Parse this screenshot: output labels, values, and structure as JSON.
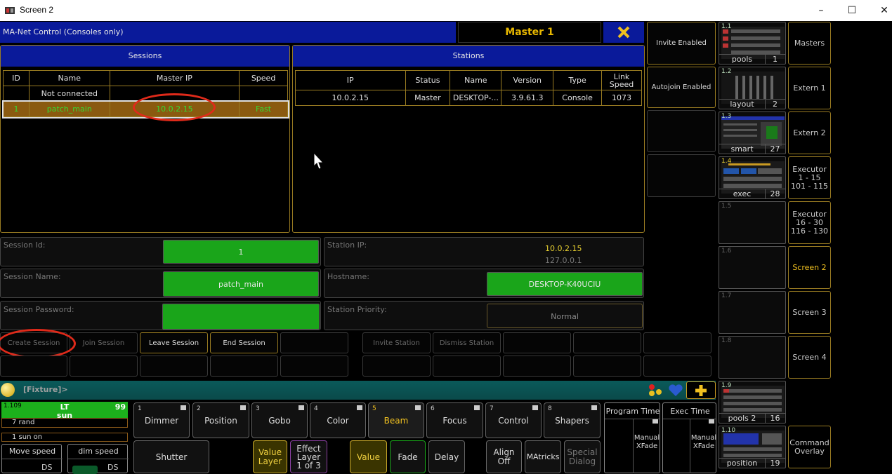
{
  "window": {
    "title": "Screen 2"
  },
  "panel": {
    "title": "MA-Net Control (Consoles only)",
    "master_label": "Master 1"
  },
  "sessions": {
    "header": "Sessions",
    "columns": [
      "ID",
      "Name",
      "Master IP",
      "Speed"
    ],
    "rows": [
      {
        "id": "",
        "name": "Not connected",
        "ip": "",
        "speed": ""
      },
      {
        "id": "1",
        "name": "patch_main",
        "ip": "10.0.2.15",
        "speed": "Fast"
      }
    ]
  },
  "stations": {
    "header": "Stations",
    "columns": [
      "IP",
      "Status",
      "Name",
      "Version",
      "Type",
      "Link Speed"
    ],
    "rows": [
      {
        "ip": "10.0.2.15",
        "status": "Master",
        "name": "DESKTOP-...",
        "version": "3.9.61.3",
        "type": "Console",
        "link": "1073"
      }
    ]
  },
  "fields": {
    "session_id_label": "Session Id:",
    "session_id": "1",
    "session_name_label": "Session Name:",
    "session_name": "patch_main",
    "session_password_label": "Session Password:",
    "session_password": "",
    "station_ip_label": "Station IP:",
    "station_ip_1": "10.0.2.15",
    "station_ip_2": "127.0.0.1",
    "hostname_label": "Hostname:",
    "hostname": "DESKTOP-K40UCIU",
    "station_priority_label": "Station Priority:",
    "station_priority": "Normal"
  },
  "actions": {
    "create_session": "Create Session",
    "join_session": "Join Session",
    "leave_session": "Leave Session",
    "end_session": "End Session",
    "invite_station": "Invite Station",
    "dismiss_station": "Dismiss Station"
  },
  "side_buttons": {
    "invite": "Invite Enabled",
    "autojoin": "Autojoin Enabled"
  },
  "views": [
    {
      "num": "1.1",
      "name": "pools",
      "count": "1"
    },
    {
      "num": "1.2",
      "name": "layout",
      "count": "2"
    },
    {
      "num": "1.3",
      "name": "smart",
      "count": "27"
    },
    {
      "num": "1.4",
      "name": "exec",
      "count": "28"
    },
    {
      "num": "1.5",
      "name": "",
      "count": ""
    },
    {
      "num": "1.6",
      "name": "",
      "count": ""
    },
    {
      "num": "1.7",
      "name": "",
      "count": ""
    },
    {
      "num": "1.8",
      "name": "",
      "count": ""
    },
    {
      "num": "1.9",
      "name": "pools 2",
      "count": "16"
    },
    {
      "num": "1.10",
      "name": "position",
      "count": "19"
    }
  ],
  "right_menu": {
    "masters": "Masters",
    "extern1": "Extern 1",
    "extern2": "Extern 2",
    "exec1_l1": "Executor",
    "exec1_l2": "1 - 15",
    "exec1_l3": "101 - 115",
    "exec2_l1": "Executor",
    "exec2_l2": "16 - 30",
    "exec2_l3": "116 - 130",
    "screen2": "Screen 2",
    "screen3": "Screen 3",
    "screen4": "Screen 4",
    "command_overlay": "Command Overlay"
  },
  "command_line": {
    "text": "[Fixture]>"
  },
  "fixture": {
    "id": "1.109",
    "label": "LT",
    "value": "99",
    "name": "sun",
    "row2": "7 rand",
    "row3": "1 sun on"
  },
  "speed": {
    "move": "Move speed",
    "dim": "dim speed",
    "ds1": "DS",
    "ds2": "DS"
  },
  "features": [
    {
      "num": "1",
      "label": "Dimmer"
    },
    {
      "num": "2",
      "label": "Position"
    },
    {
      "num": "3",
      "label": "Gobo"
    },
    {
      "num": "4",
      "label": "Color"
    },
    {
      "num": "5",
      "label": "Beam"
    },
    {
      "num": "6",
      "label": "Focus"
    },
    {
      "num": "7",
      "label": "Control"
    },
    {
      "num": "8",
      "label": "Shapers"
    }
  ],
  "bottom": {
    "shutter": "Shutter",
    "value_layer": "Value Layer",
    "effect_layer_1": "Effect",
    "effect_layer_2": "Layer",
    "effect_layer_3": "1 of 3",
    "value": "Value",
    "fade": "Fade",
    "delay": "Delay",
    "align": "Align Off",
    "matricks": "MAtricks",
    "special": "Special Dialog",
    "program_time": "Program Time",
    "exec_time": "Exec Time",
    "manual_xfade": "Manual XFade"
  },
  "colors": {
    "accent": "#9a7c22",
    "header_blue": "#0a1a9a",
    "green": "#1aa51a",
    "highlight": "#ffcc00"
  }
}
